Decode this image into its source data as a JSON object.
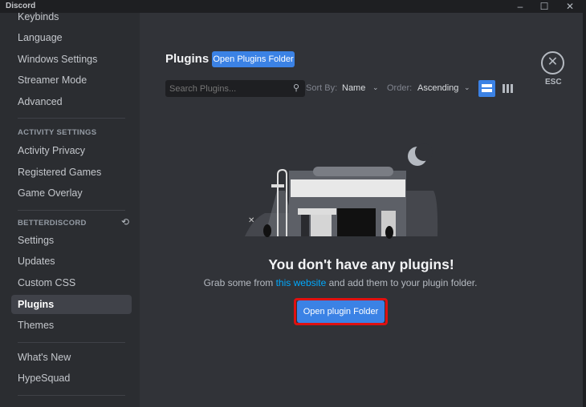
{
  "window": {
    "title": "Discord",
    "minimize": "–",
    "maximize": "☐",
    "close": "✕"
  },
  "sidebar": {
    "items_top": [
      "Keybinds",
      "Language",
      "Windows Settings",
      "Streamer Mode",
      "Advanced"
    ],
    "activity_header": "ACTIVITY SETTINGS",
    "activity_items": [
      "Activity Privacy",
      "Registered Games",
      "Game Overlay"
    ],
    "bd_header": "BETTERDISCORD",
    "bd_items": [
      "Settings",
      "Updates",
      "Custom CSS",
      "Plugins",
      "Themes"
    ],
    "bottom_items": [
      "What's New",
      "HypeSquad"
    ],
    "active": "Plugins"
  },
  "header": {
    "title": "Plugins",
    "open_folder": "Open Plugins Folder",
    "esc": "ESC"
  },
  "toolbar": {
    "search_placeholder": "Search Plugins...",
    "sort_label": "Sort By:",
    "sort_value": "Name",
    "order_label": "Order:",
    "order_value": "Ascending"
  },
  "empty": {
    "title": "You don't have any plugins!",
    "text_before": "Grab some from ",
    "link": "this website",
    "text_after": " and add them to your plugin folder.",
    "button": "Open plugin Folder"
  },
  "colors": {
    "accent": "#3b82e5",
    "link": "#00a8fc",
    "highlight": "#e01010"
  }
}
